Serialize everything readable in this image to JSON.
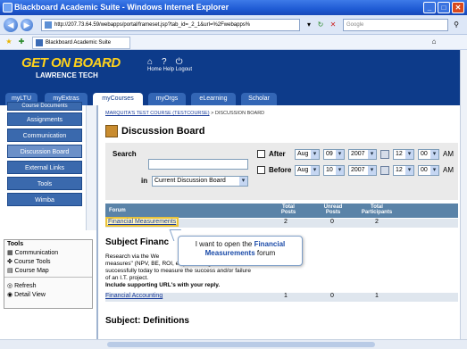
{
  "window": {
    "title": "Blackboard Academic Suite - Windows Internet Explorer",
    "controls": [
      "_",
      "□",
      "✕"
    ]
  },
  "browser": {
    "url": "http://207.73.64.59/webapps/portal/frameset.jsp?tab_id=_2_1&url=%2Fwebapps%",
    "search_placeholder": "Google",
    "tab_label": "Blackboard Academic Suite",
    "back_glyph": "◀",
    "fwd_glyph": "▶"
  },
  "header": {
    "logo_line1": "GET ON BOARD",
    "logo_line2": "LAWRENCE TECH",
    "links": "Home  Help  Logout"
  },
  "tabs": [
    "myLTU",
    "myExtras",
    "myCourses",
    "myOrgs",
    "eLearning",
    "Scholar"
  ],
  "left_menu": {
    "top_cut": "Course Documents",
    "items": [
      "Assignments",
      "Communication",
      "Discussion Board",
      "External Links",
      "Tools",
      "Wimba"
    ],
    "tools_title": "Tools",
    "tools": [
      "Communication",
      "Course Tools",
      "Course Map"
    ],
    "tools2": [
      "Refresh",
      "Detail View"
    ]
  },
  "content": {
    "breadcrumb_link": "MARQUITA'S TEST COURSE (TESTCOURSE)",
    "breadcrumb_tail": " > DISCUSSION BOARD",
    "page_title": "Discussion Board",
    "search_label": "Search",
    "in_label": "in",
    "scope_select": "Current Discussion Board",
    "after_label": "After",
    "before_label": "Before",
    "after_month": "Aug",
    "after_day": "09",
    "after_year": "2007",
    "after_hour": "12",
    "after_min": "00",
    "after_ampm": "AM",
    "before_month": "Aug",
    "before_day": "10",
    "before_year": "2007",
    "before_hour": "12",
    "before_min": "00",
    "before_ampm": "AM",
    "col_forum": "Forum",
    "col_total": "Total Posts",
    "col_unread": "Unread Posts",
    "col_participants": "Total Participants",
    "forum1": "Financial Measurements",
    "forum1_total": "2",
    "forum1_unread": "0",
    "forum1_participants": "2",
    "subject1": "Subject Financ",
    "para1": "Research via the We",
    "para2": "measures\" (NPV, BE, ROI, etc) are being used",
    "para3": "successfully today to measure the success and/or failure",
    "para4": "of an I.T. project.",
    "para5": "Include supporting URL's with your reply.",
    "forum2": "Financial Accounting",
    "forum2_total": "1",
    "forum2_unread": "0",
    "forum2_participants": "1",
    "subject2": "Subject: Definitions"
  },
  "callout": {
    "pre": "I want to open the ",
    "bold": "Financial Measurements",
    "post": " forum"
  }
}
